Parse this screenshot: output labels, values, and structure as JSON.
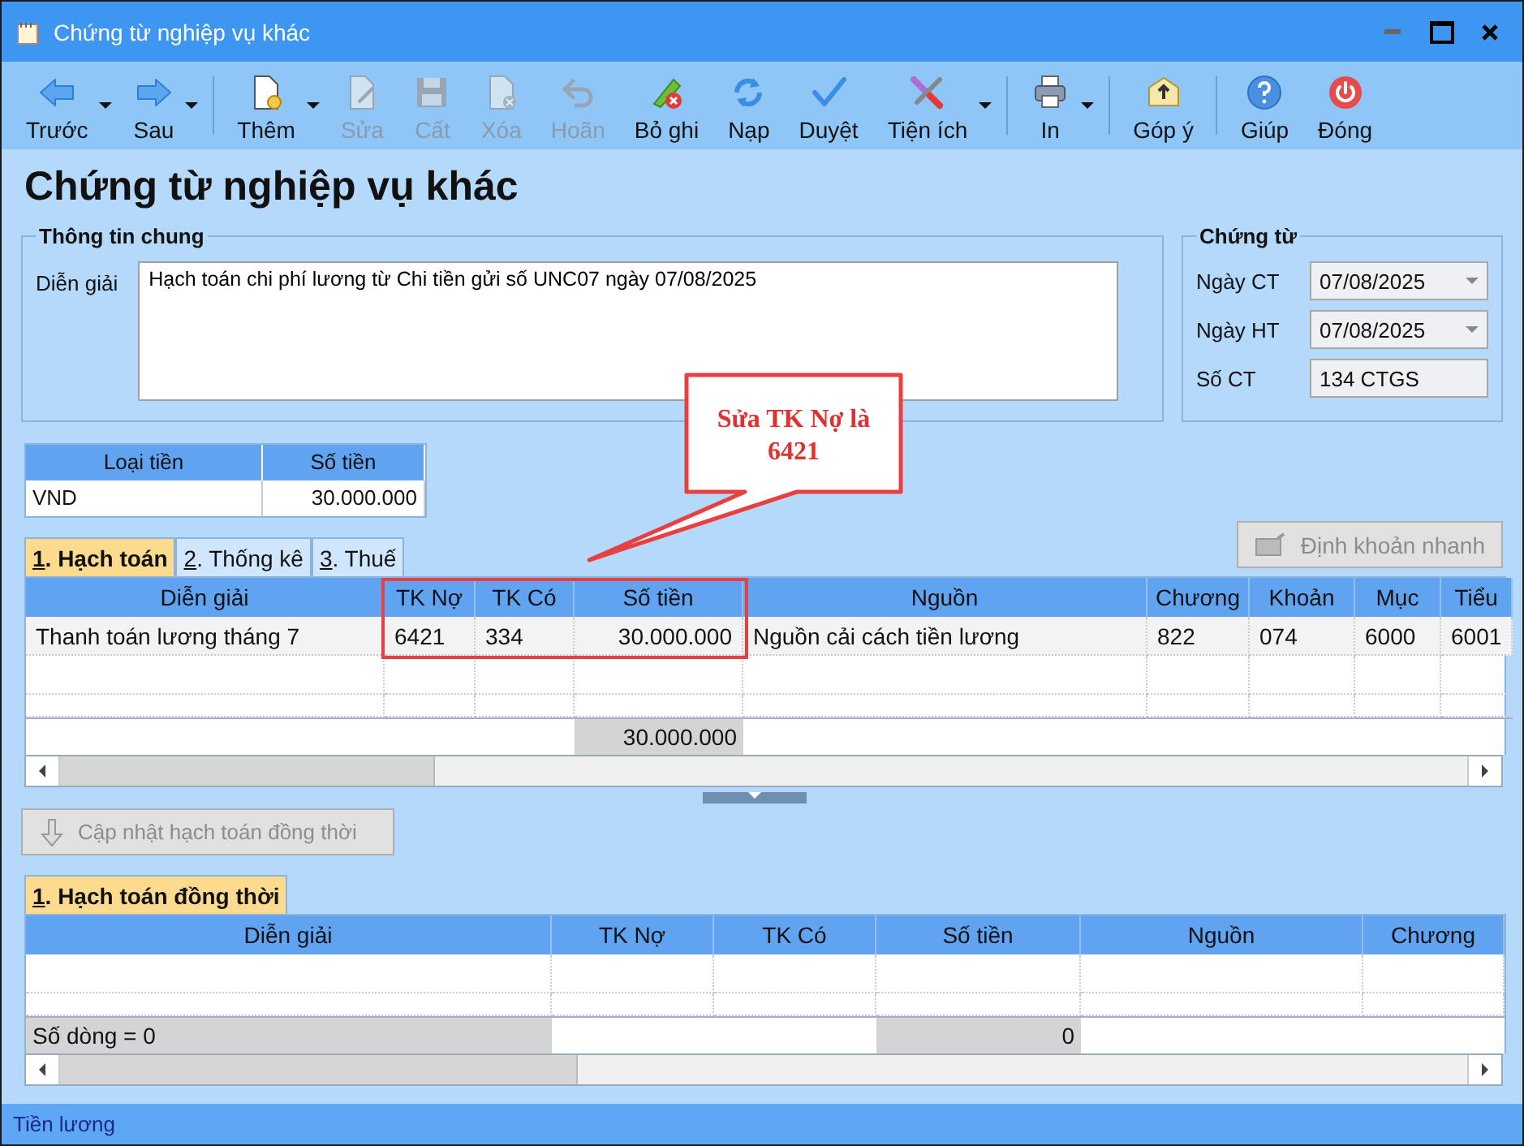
{
  "window": {
    "title": "Chứng từ nghiệp vụ khác"
  },
  "toolbar": {
    "groups": [
      [
        {
          "label": "Trước",
          "disabled": false,
          "dropdown": true
        },
        {
          "label": "Sau",
          "disabled": false,
          "dropdown": true
        }
      ],
      [
        {
          "label": "Thêm",
          "disabled": false,
          "dropdown": true
        },
        {
          "label": "Sửa",
          "disabled": true,
          "dropdown": false
        },
        {
          "label": "Cất",
          "disabled": true,
          "dropdown": false
        },
        {
          "label": "Xóa",
          "disabled": true,
          "dropdown": false
        },
        {
          "label": "Hoãn",
          "disabled": true,
          "dropdown": false
        },
        {
          "label": "Bỏ ghi",
          "disabled": false,
          "dropdown": false
        },
        {
          "label": "Nạp",
          "disabled": false,
          "dropdown": false
        },
        {
          "label": "Duyệt",
          "disabled": false,
          "dropdown": false
        },
        {
          "label": "Tiện ích",
          "disabled": false,
          "dropdown": true
        }
      ],
      [
        {
          "label": "In",
          "disabled": false,
          "dropdown": true
        }
      ],
      [
        {
          "label": "Góp ý",
          "disabled": false,
          "dropdown": false
        }
      ],
      [
        {
          "label": "Giúp",
          "disabled": false,
          "dropdown": false
        },
        {
          "label": "Đóng",
          "disabled": false,
          "dropdown": false
        }
      ]
    ]
  },
  "heading": "Chứng từ nghiệp vụ khác",
  "general": {
    "title": "Thông tin chung",
    "description_label": "Diễn giải",
    "description": "Hạch toán chi phí lương từ Chi tiền gửi số UNC07 ngày 07/08/2025"
  },
  "document": {
    "title": "Chứng từ",
    "fields": [
      {
        "label": "Ngày CT",
        "value": "07/08/2025",
        "kind": "date"
      },
      {
        "label": "Ngày HT",
        "value": "07/08/2025",
        "kind": "date"
      },
      {
        "label": "Số CT",
        "value": "134 CTGS",
        "kind": "text"
      }
    ]
  },
  "currency": {
    "columns": [
      "Loại tiền",
      "Số tiền"
    ],
    "row": [
      "VND",
      "30.000.000"
    ]
  },
  "tabs": [
    {
      "label": "1. Hạch toán",
      "selected": true
    },
    {
      "label": "2. Thống kê",
      "selected": false
    },
    {
      "label": "3. Thuế",
      "selected": false
    }
  ],
  "quick_entry_button": {
    "label": "Định khoản nhanh",
    "disabled": true
  },
  "entries": {
    "columns": [
      "Diễn giải",
      "TK Nợ",
      "TK Có",
      "Số tiền",
      "Nguồn",
      "Chương",
      "Khoản",
      "Mục",
      "Tiểu"
    ],
    "rows": [
      [
        "Thanh toán lương tháng 7",
        "6421",
        "334",
        "30.000.000",
        "Nguồn cải cách tiền lương",
        "822",
        "074",
        "6000",
        "6001"
      ]
    ],
    "total_amount": "30.000.000"
  },
  "update_button": {
    "label": "Cập nhật hạch toán đồng thời",
    "disabled": true
  },
  "sub_tabs": [
    {
      "label": "1. Hạch toán đồng thời",
      "selected": true
    }
  ],
  "sub_entries": {
    "columns": [
      "Diễn giải",
      "TK Nợ",
      "TK Có",
      "Số tiền",
      "Nguồn",
      "Chương"
    ],
    "row_count": "Số dòng = 0",
    "total_amount": "0"
  },
  "callout": {
    "text": "Sửa TK Nợ là 6421"
  },
  "status_bar": "Tiền lương"
}
